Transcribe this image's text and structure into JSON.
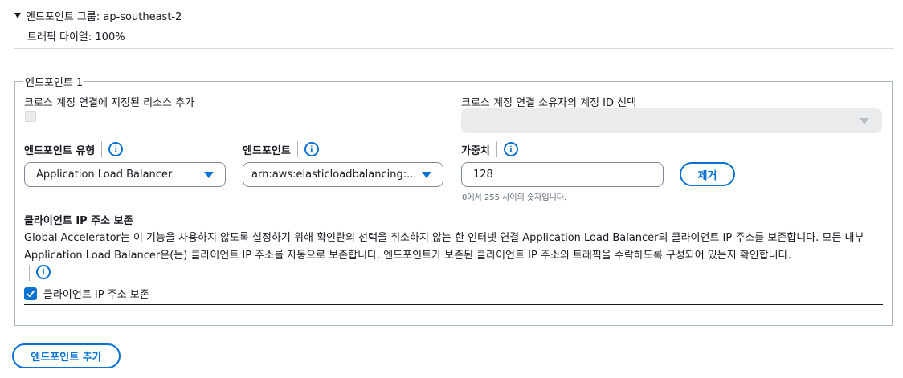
{
  "group": {
    "title": "엔드포인트 그룹: ap-southeast-2",
    "traffic_dial": "트래픽 다이얼: 100%"
  },
  "endpoint": {
    "legend": "엔드포인트 1",
    "cross_account_label": "크로스 계정 연결에 지정된 리소스 추가",
    "cross_account_owner_label": "크로스 계정 연결 소유자의 계정 ID 선택",
    "type_label": "엔드포인트 유형",
    "type_value": "Application Load Balancer",
    "endpoint_label": "엔드포인트",
    "endpoint_value": "arn:aws:elasticloadbalancing:...",
    "weight_label": "가중치",
    "weight_value": "128",
    "weight_hint": "0에서 255 사이의 숫자입니다.",
    "remove_button": "제거",
    "client_ip_heading": "클라이언트 IP 주소 보존",
    "client_ip_desc_1": "Global Accelerator는 이 기능을 사용하지 않도록 설정하기 위해 확인란의 선택을 취소하지 않는 한 인터넷 연결 Application Load Balancer의 클라이언트 IP 주소를 보존합니다. 모든 내부",
    "client_ip_desc_2": "Application Load Balancer은(는) 클라이언트 IP 주소를 자동으로 보존합니다. 엔드포인트가 보존된 클라이언트 IP 주소의 트래픽을 수락하도록 구성되어 있는지 확인합니다.",
    "client_ip_checkbox_label": "클라이언트 IP 주소 보존",
    "client_ip_checked": true
  },
  "add_endpoint_button": "엔드포인트 추가",
  "colors": {
    "accent": "#0972d3",
    "text": "#16191f",
    "border": "#7d8998",
    "disabled": "#e9ebed"
  }
}
